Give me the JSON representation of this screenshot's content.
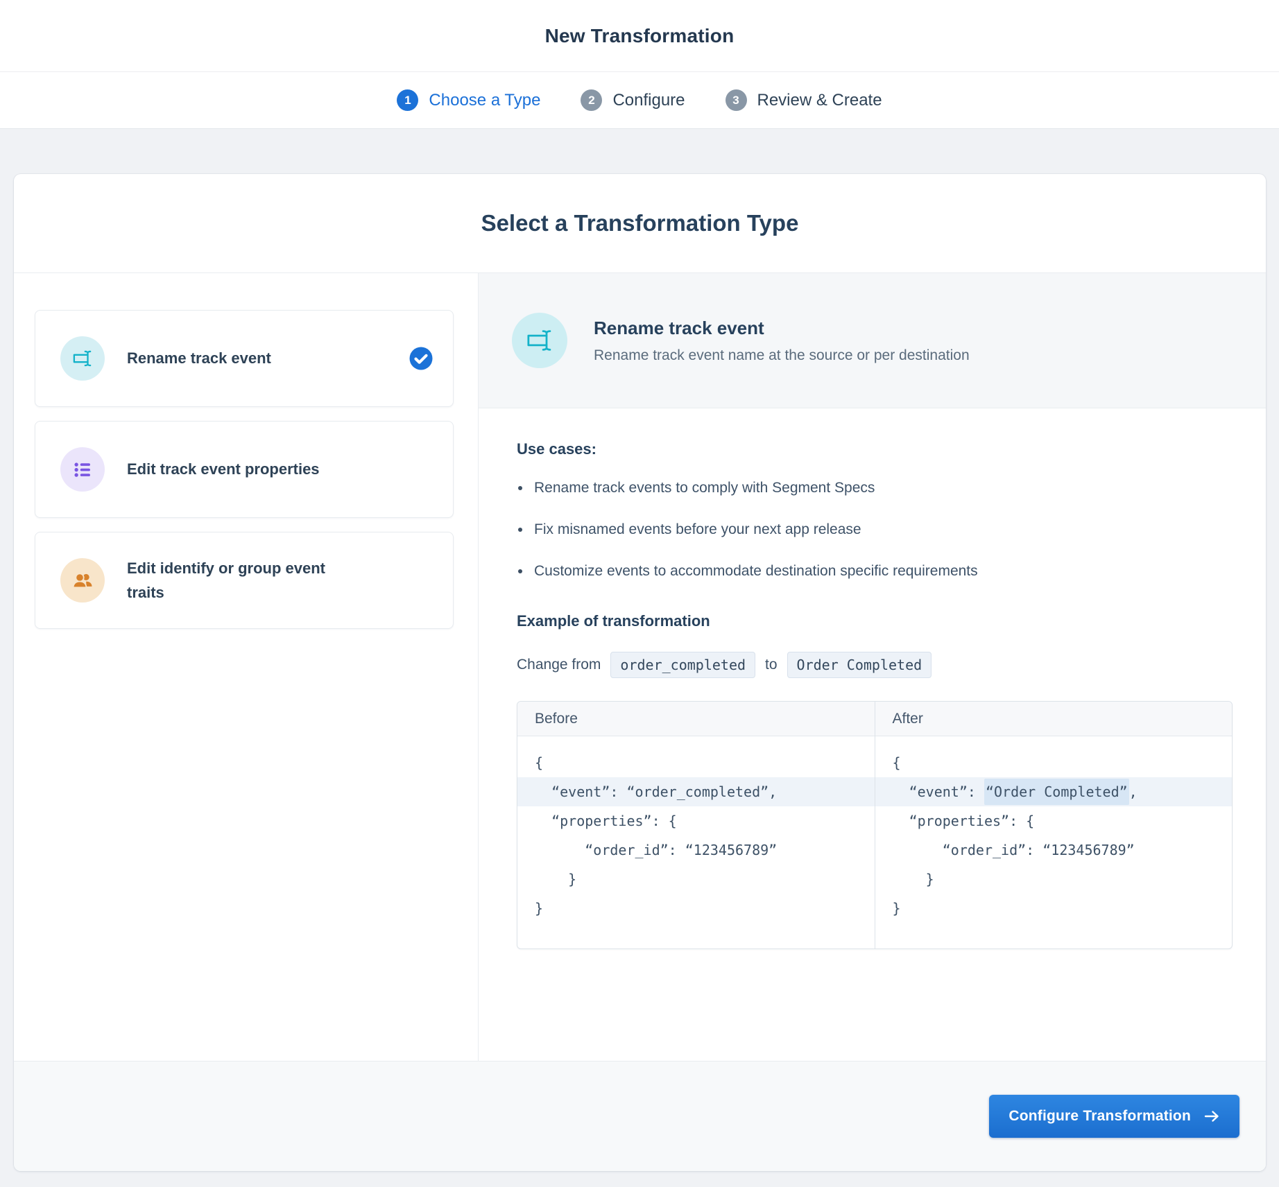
{
  "header": {
    "title": "New Transformation"
  },
  "stepper": {
    "steps": [
      {
        "number": "1",
        "label": "Choose a Type",
        "active": true
      },
      {
        "number": "2",
        "label": "Configure",
        "active": false
      },
      {
        "number": "3",
        "label": "Review & Create",
        "active": false
      }
    ]
  },
  "card": {
    "title": "Select a Transformation Type"
  },
  "options": [
    {
      "label": "Rename track event",
      "icon": "rename-icon",
      "selected": true
    },
    {
      "label": "Edit track event properties",
      "icon": "list-properties-icon",
      "selected": false
    },
    {
      "label": "Edit identify or group event traits",
      "icon": "users-icon",
      "selected": false
    }
  ],
  "detail": {
    "title": "Rename track event",
    "description": "Rename track event name at the source or per destination",
    "use_cases_heading": "Use cases:",
    "use_cases": [
      "Rename track events to comply with Segment Specs",
      "Fix misnamed events before your next app release",
      "Customize events to accommodate destination specific requirements"
    ],
    "example_heading": "Example of transformation",
    "change_from_label": "Change from",
    "change_from_code": "order_completed",
    "change_to_label": "to",
    "change_to_code": "Order Completed",
    "compare": {
      "before_label": "Before",
      "after_label": "After"
    },
    "code": {
      "open_brace": "{",
      "event_prefix": "  “event”: ",
      "before_event_value": "“order_completed”",
      "after_event_value": "“Order Completed”",
      "comma": ",",
      "properties_line": "  “properties”: {",
      "order_id_line": "      “order_id”: “123456789”",
      "inner_close": "    }",
      "close_brace": "}"
    }
  },
  "footer": {
    "configure_button": "Configure Transformation"
  },
  "colors": {
    "accent_blue": "#1c72d8",
    "step_inactive_gray": "#8997a6",
    "heading_navy": "#27415c",
    "body_text": "#3e5268",
    "cyan_icon": "#14b2c9",
    "cyan_icon_bg": "#d5eff4",
    "purple_icon": "#7a55e2",
    "purple_icon_bg": "#ebe5fb",
    "orange_icon": "#d8822c",
    "orange_icon_bg": "#f8e5ca",
    "row_highlight": "#eef3f9",
    "value_highlight": "#d7e6f5",
    "button_gradient_top": "#2e86e1",
    "button_gradient_bottom": "#1b6ecf"
  }
}
